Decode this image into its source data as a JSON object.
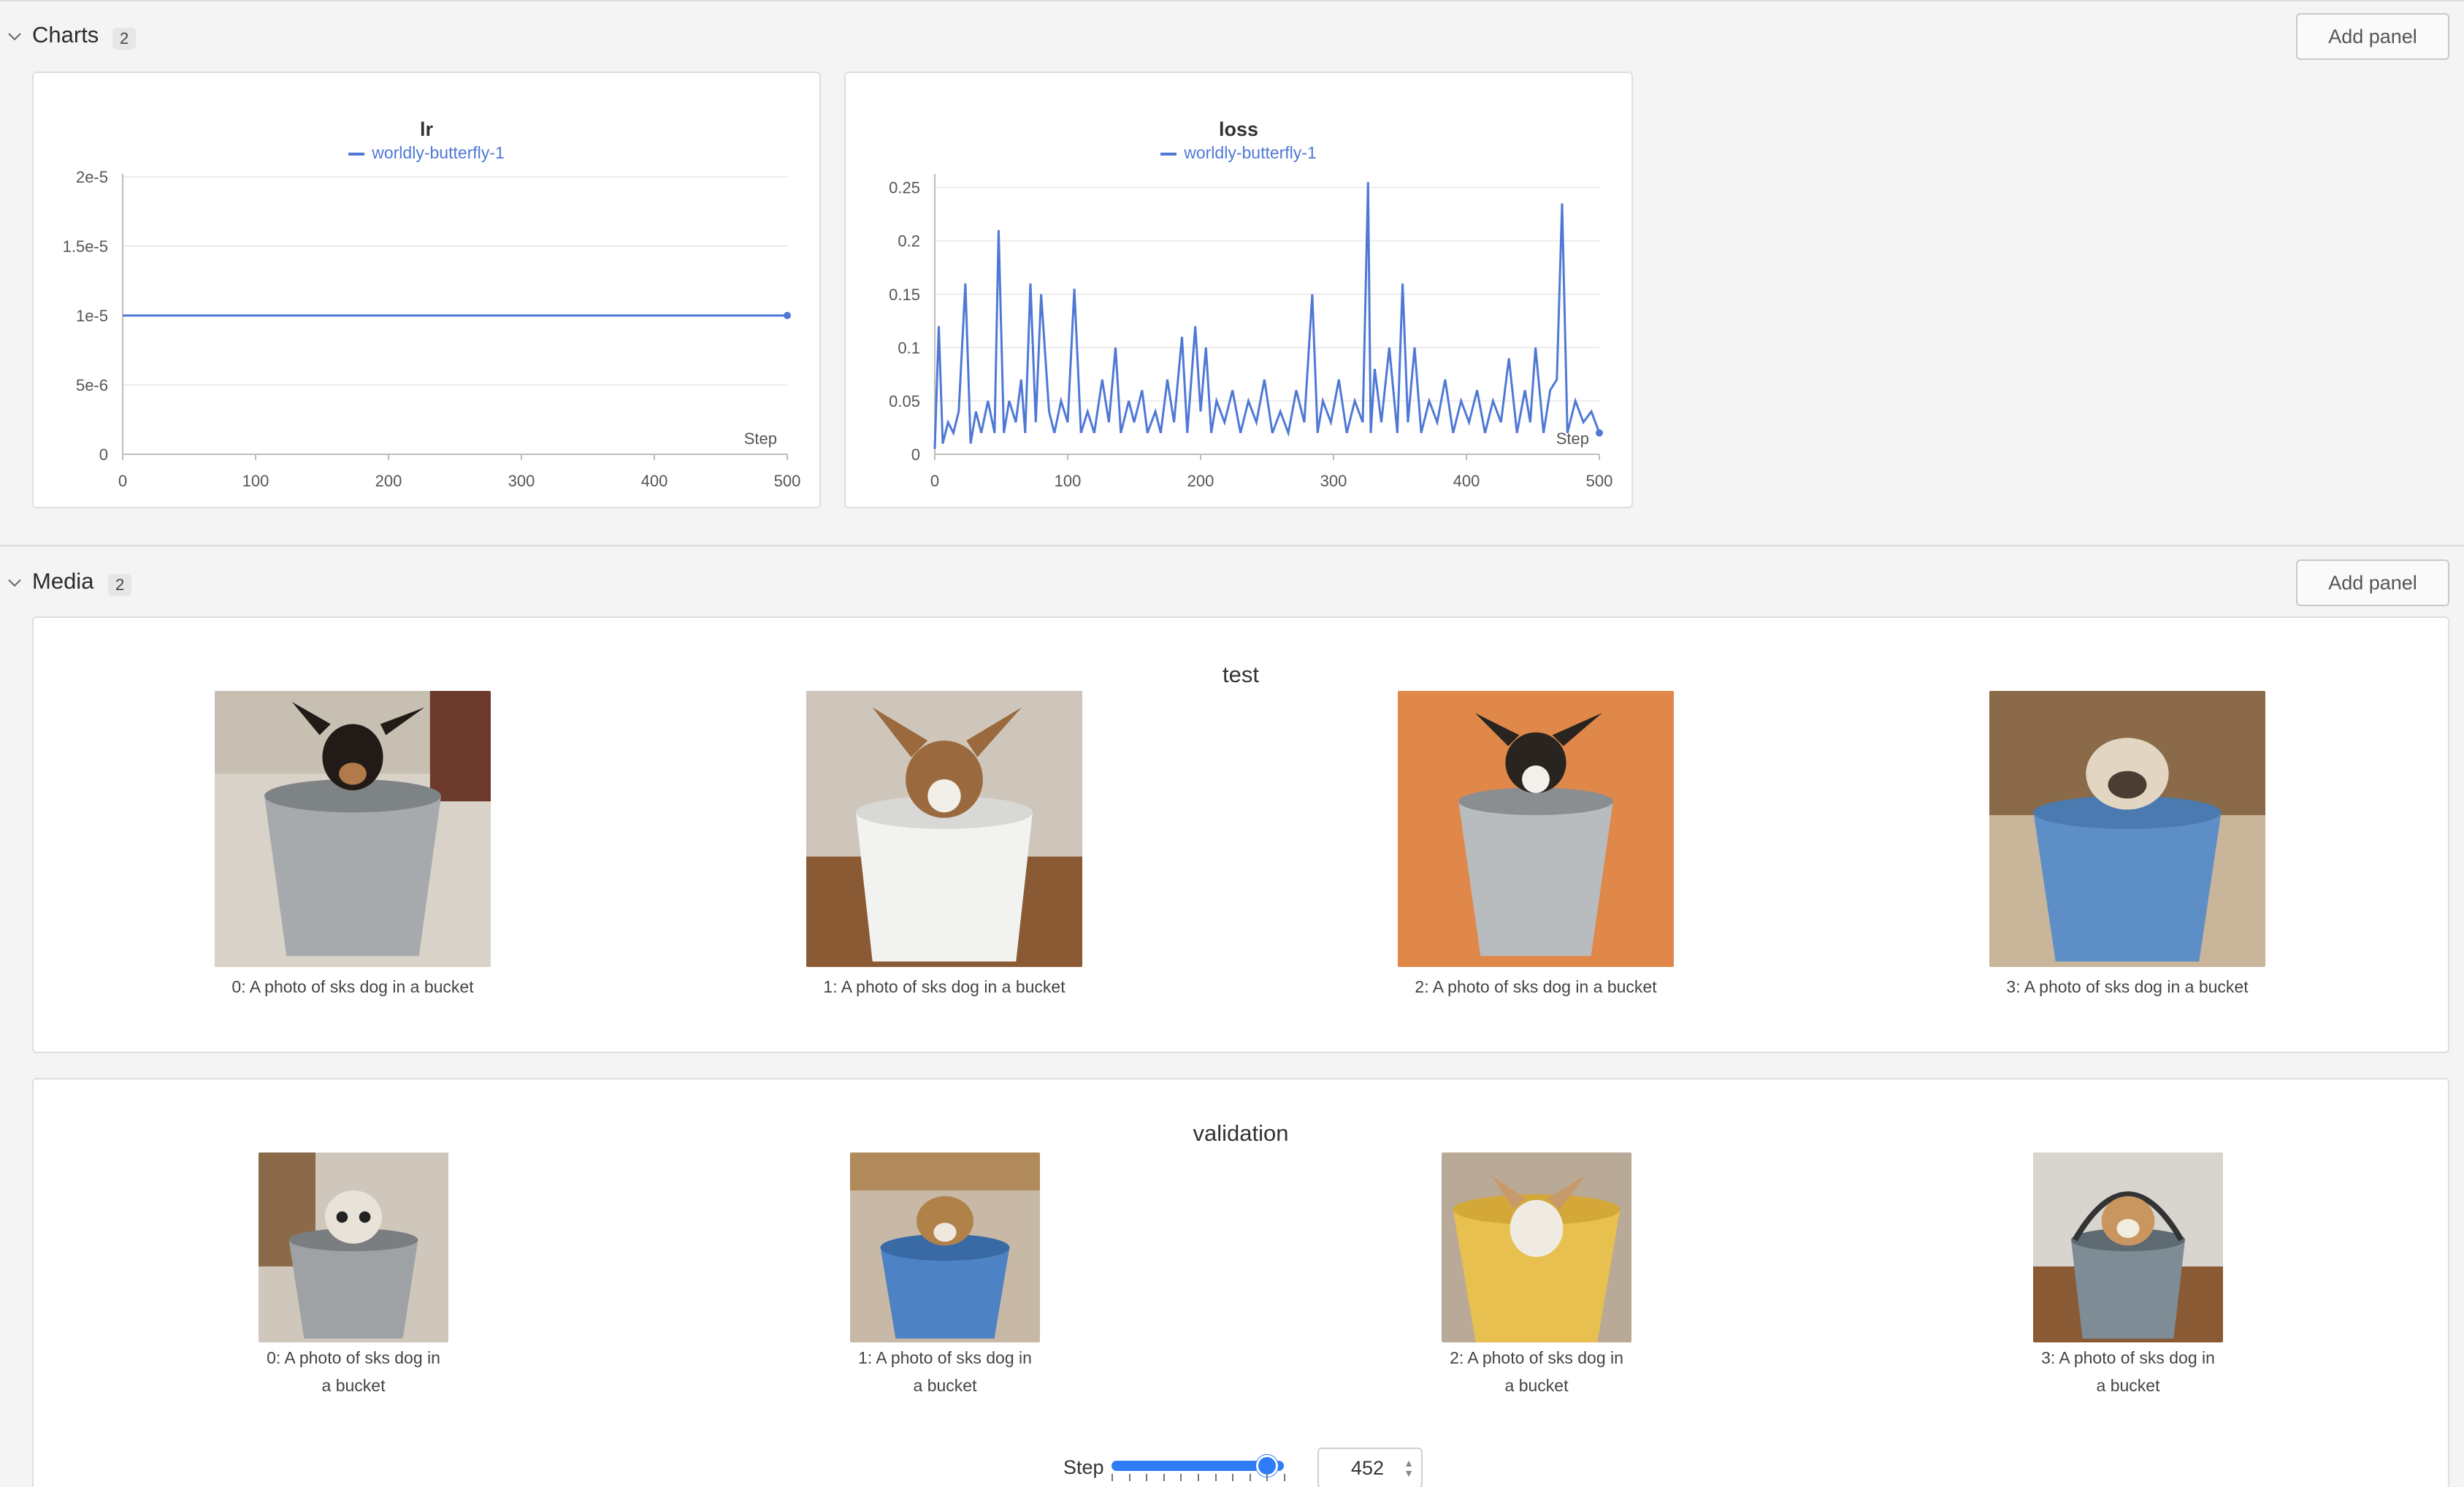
{
  "sections": {
    "charts": {
      "title": "Charts",
      "count": "2",
      "add_label": "Add panel"
    },
    "media": {
      "title": "Media",
      "count": "2",
      "add_label": "Add panel"
    }
  },
  "charts": [
    {
      "title": "lr",
      "legend": "worldly-butterfly-1",
      "x_ticks": [
        "0",
        "100",
        "200",
        "300",
        "400",
        "500"
      ],
      "y_ticks": [
        "2e-5",
        "1.5e-5",
        "1e-5",
        "5e-6",
        "0"
      ],
      "step_label": "Step"
    },
    {
      "title": "loss",
      "legend": "worldly-butterfly-1",
      "x_ticks": [
        "0",
        "100",
        "200",
        "300",
        "400",
        "500"
      ],
      "y_ticks": [
        "0.25",
        "0.2",
        "0.15",
        "0.1",
        "0.05",
        "0"
      ],
      "step_label": "Step"
    }
  ],
  "chart_data": [
    {
      "type": "line",
      "title": "lr",
      "xlabel": "Step",
      "ylabel": "",
      "xlim": [
        0,
        500
      ],
      "ylim": [
        0,
        2e-05
      ],
      "series": [
        {
          "name": "worldly-butterfly-1",
          "x": [
            0,
            100,
            200,
            300,
            400,
            500
          ],
          "y": [
            1e-05,
            1e-05,
            1e-05,
            1e-05,
            1e-05,
            1e-05
          ]
        }
      ]
    },
    {
      "type": "line",
      "title": "loss",
      "xlabel": "Step",
      "ylabel": "",
      "xlim": [
        0,
        500
      ],
      "ylim": [
        0,
        0.26
      ],
      "series": [
        {
          "name": "worldly-butterfly-1",
          "x": [
            0,
            3,
            6,
            10,
            14,
            18,
            23,
            27,
            31,
            35,
            40,
            45,
            48,
            52,
            56,
            61,
            65,
            68,
            72,
            76,
            80,
            86,
            90,
            95,
            100,
            105,
            110,
            115,
            120,
            126,
            131,
            136,
            140,
            146,
            150,
            156,
            160,
            166,
            170,
            175,
            180,
            186,
            190,
            196,
            200,
            204,
            208,
            212,
            218,
            224,
            230,
            236,
            242,
            248,
            254,
            260,
            266,
            272,
            278,
            284,
            288,
            292,
            298,
            304,
            310,
            316,
            322,
            326,
            328,
            331,
            336,
            342,
            348,
            352,
            356,
            361,
            366,
            372,
            378,
            384,
            390,
            396,
            402,
            408,
            414,
            420,
            426,
            432,
            438,
            444,
            448,
            452,
            458,
            463,
            468,
            472,
            476,
            482,
            488,
            494,
            500
          ],
          "y": [
            0.005,
            0.12,
            0.01,
            0.03,
            0.02,
            0.04,
            0.16,
            0.01,
            0.04,
            0.02,
            0.05,
            0.02,
            0.21,
            0.02,
            0.05,
            0.03,
            0.07,
            0.02,
            0.16,
            0.03,
            0.15,
            0.04,
            0.02,
            0.05,
            0.03,
            0.155,
            0.02,
            0.04,
            0.02,
            0.07,
            0.03,
            0.1,
            0.02,
            0.05,
            0.03,
            0.06,
            0.02,
            0.04,
            0.02,
            0.07,
            0.03,
            0.11,
            0.02,
            0.12,
            0.04,
            0.1,
            0.02,
            0.05,
            0.03,
            0.06,
            0.02,
            0.05,
            0.03,
            0.07,
            0.02,
            0.04,
            0.02,
            0.06,
            0.03,
            0.15,
            0.02,
            0.05,
            0.03,
            0.07,
            0.02,
            0.05,
            0.03,
            0.255,
            0.02,
            0.08,
            0.03,
            0.1,
            0.02,
            0.16,
            0.03,
            0.1,
            0.02,
            0.05,
            0.03,
            0.07,
            0.02,
            0.05,
            0.03,
            0.06,
            0.02,
            0.05,
            0.03,
            0.09,
            0.02,
            0.06,
            0.03,
            0.1,
            0.02,
            0.06,
            0.07,
            0.235,
            0.02,
            0.05,
            0.03,
            0.04,
            0.02
          ]
        }
      ]
    }
  ],
  "media": {
    "test": {
      "title": "test",
      "captions": [
        "0: A photo of sks dog in a bucket",
        "1: A photo of sks dog in a bucket",
        "2: A photo of sks dog in a bucket",
        "3: A photo of sks dog in a bucket"
      ]
    },
    "validation": {
      "title": "validation",
      "captions": [
        [
          "0: A photo of sks dog in",
          "a bucket"
        ],
        [
          "1: A photo of sks dog in",
          "a bucket"
        ],
        [
          "2: A photo of sks dog in",
          "a bucket"
        ],
        [
          "3: A photo of sks dog in",
          "a bucket"
        ]
      ],
      "step_label": "Step",
      "step_value": "452",
      "step_max": 500
    }
  },
  "colors": {
    "line": "#4f78d6",
    "accent": "#2f7cf6"
  }
}
